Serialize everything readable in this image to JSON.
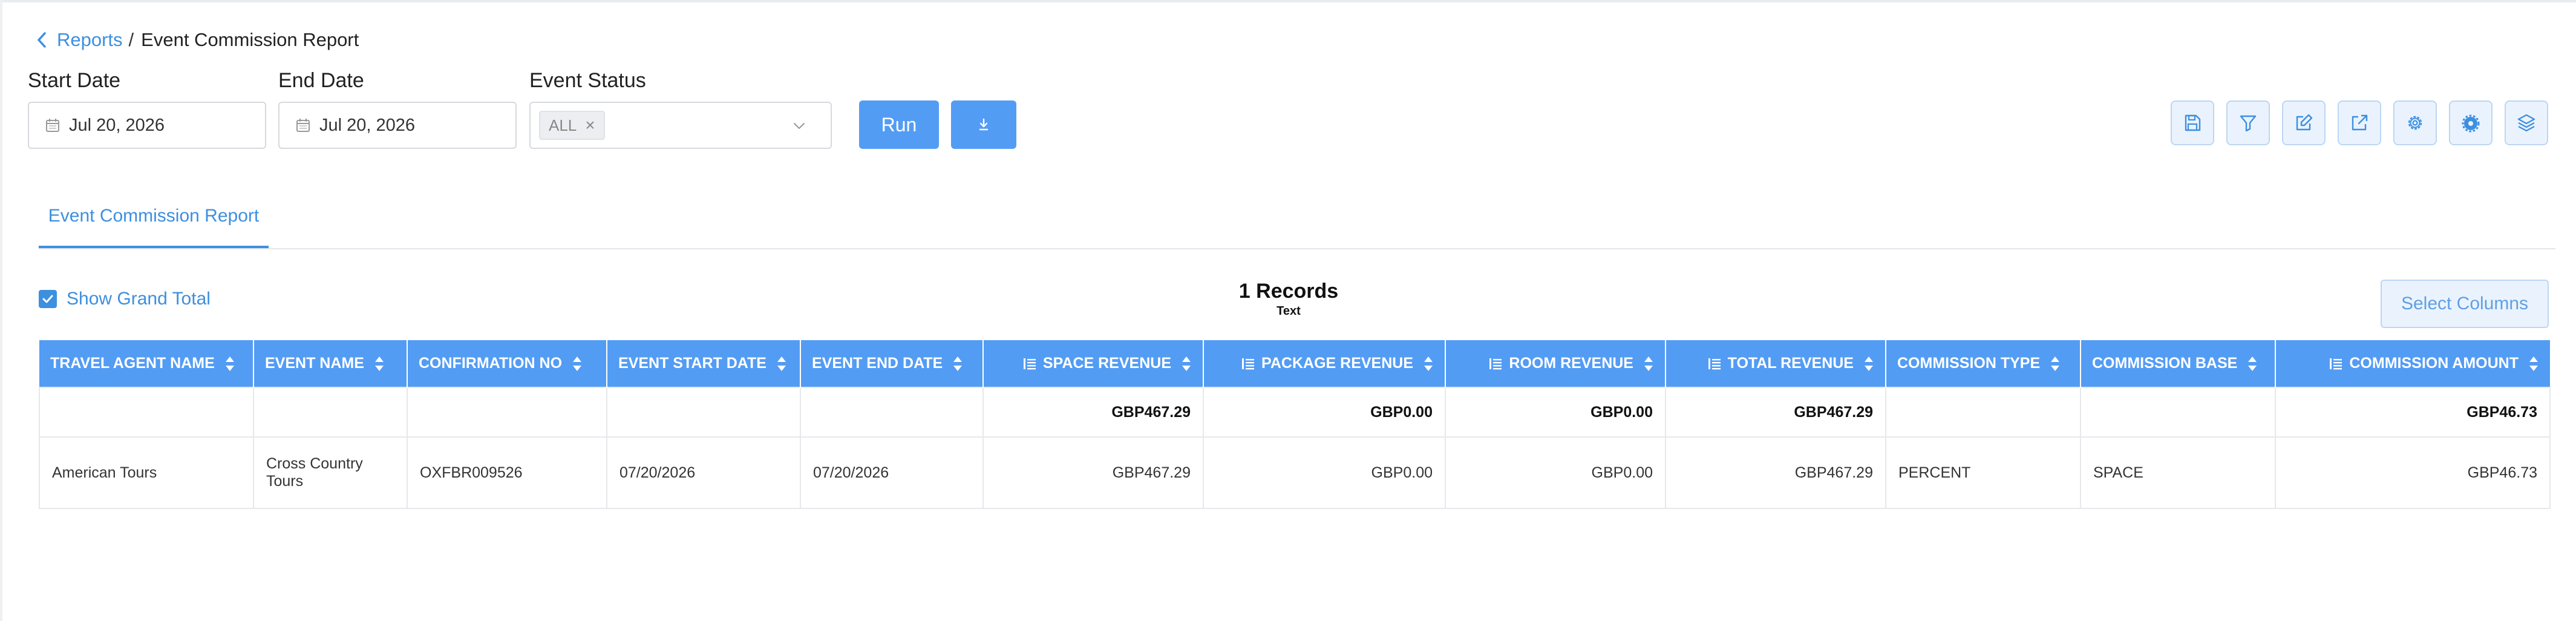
{
  "breadcrumb": {
    "parent": "Reports",
    "separator": "/",
    "current": "Event Commission Report"
  },
  "filters": {
    "start_date": {
      "label": "Start Date",
      "value": "Jul 20, 2026"
    },
    "end_date": {
      "label": "End Date",
      "value": "Jul 20, 2026"
    },
    "event_status": {
      "label": "Event Status",
      "chip": "ALL"
    }
  },
  "actions": {
    "run_label": "Run"
  },
  "toolbar_icons": [
    "save-icon",
    "filter-icon",
    "edit-icon",
    "external-link-icon",
    "settings-icon",
    "gear-badge-icon",
    "layers-icon"
  ],
  "tabs": [
    {
      "label": "Event Commission Report",
      "active": true
    }
  ],
  "grand_total": {
    "label": "Show Grand Total",
    "checked": true
  },
  "records": {
    "count_label": "1 Records",
    "sub_label": "Text"
  },
  "select_columns_label": "Select Columns",
  "colors": {
    "accent": "#539cf4",
    "link": "#3d8fe0"
  },
  "table": {
    "columns": [
      {
        "label": "TRAVEL AGENT NAME"
      },
      {
        "label": "EVENT NAME"
      },
      {
        "label": "CONFIRMATION NO"
      },
      {
        "label": "EVENT START DATE"
      },
      {
        "label": "EVENT END DATE"
      },
      {
        "label": "SPACE REVENUE"
      },
      {
        "label": "PACKAGE REVENUE"
      },
      {
        "label": "ROOM REVENUE"
      },
      {
        "label": "TOTAL REVENUE"
      },
      {
        "label": "COMMISSION TYPE"
      },
      {
        "label": "COMMISSION BASE"
      },
      {
        "label": "COMMISSION AMOUNT"
      }
    ],
    "totals": {
      "space_revenue": "GBP467.29",
      "package_revenue": "GBP0.00",
      "room_revenue": "GBP0.00",
      "total_revenue": "GBP467.29",
      "commission_amount": "GBP46.73"
    },
    "rows": [
      {
        "travel_agent_name": "American Tours",
        "event_name": "Cross Country Tours",
        "confirmation_no": "OXFBR009526",
        "event_start_date": "07/20/2026",
        "event_end_date": "07/20/2026",
        "space_revenue": "GBP467.29",
        "package_revenue": "GBP0.00",
        "room_revenue": "GBP0.00",
        "total_revenue": "GBP467.29",
        "commission_type": "PERCENT",
        "commission_base": "SPACE",
        "commission_amount": "GBP46.73"
      }
    ]
  }
}
